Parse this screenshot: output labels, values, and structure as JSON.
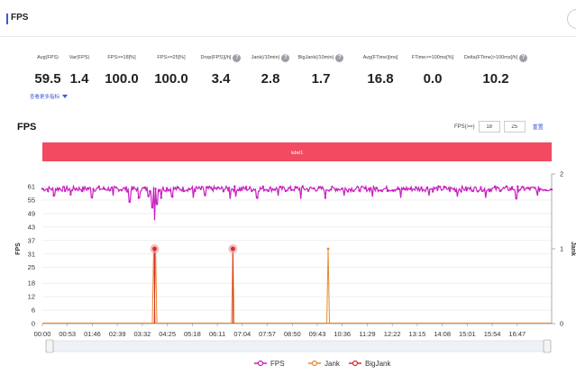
{
  "header": {
    "title": "FPS"
  },
  "metrics": [
    {
      "label": "Avg(FPS)",
      "value": "59.5",
      "help": false
    },
    {
      "label": "Var(FPS)",
      "value": "1.4",
      "help": false
    },
    {
      "label": "FPS>=18[%]",
      "value": "100.0",
      "help": false
    },
    {
      "label": "FPS>=25[%]",
      "value": "100.0",
      "help": false
    },
    {
      "label": "Drop(FPS)[/h]",
      "value": "3.4",
      "help": true
    },
    {
      "label": "Jank(/10min)",
      "value": "2.8",
      "help": true
    },
    {
      "label": "BigJank(/10min)",
      "value": "1.7",
      "help": true
    },
    {
      "label": "Avg(FTime)[ms]",
      "value": "16.8",
      "help": false
    },
    {
      "label": "FTime>=100ms[%]",
      "value": "0.0",
      "help": false
    },
    {
      "label": "Delta(FTime)>100ms[/h]",
      "value": "10.2",
      "help": true
    }
  ],
  "more_link": {
    "label": "查看更多指标"
  },
  "chart_header": {
    "title": "FPS"
  },
  "fps_filter": {
    "label": "FPS(>=)",
    "low": "18",
    "high": "25",
    "reset_label": "重置"
  },
  "chart_data": {
    "type": "line",
    "title": "FPS",
    "band_label": "label1",
    "ylabel": "FPS",
    "y2label": "Jank",
    "ylim": [
      0,
      61
    ],
    "y_ticks": [
      0,
      6,
      12,
      18,
      25,
      31,
      37,
      43,
      49,
      55,
      61
    ],
    "y2lim": [
      0,
      2
    ],
    "y2_ticks": [
      0,
      1,
      2
    ],
    "x_ticks": [
      "00:00",
      "00:53",
      "01:46",
      "02:39",
      "03:32",
      "04:25",
      "05:18",
      "06:11",
      "07:04",
      "07:57",
      "08:50",
      "09:43",
      "10:36",
      "11:29",
      "12:22",
      "13:15",
      "14:08",
      "15:01",
      "15:54",
      "16:47"
    ],
    "x_range_seconds": [
      0,
      1080
    ],
    "series": [
      {
        "name": "FPS",
        "color": "#c71fbf",
        "baseline": 60,
        "dips": [
          [
            25,
            57
          ],
          [
            60,
            57.5
          ],
          [
            105,
            56
          ],
          [
            150,
            57
          ],
          [
            185,
            54
          ],
          [
            205,
            56
          ],
          [
            225,
            56.5
          ],
          [
            233,
            51.5
          ],
          [
            238,
            46
          ],
          [
            243,
            53
          ],
          [
            252,
            56
          ],
          [
            275,
            56.5
          ],
          [
            320,
            56
          ],
          [
            345,
            57
          ],
          [
            398,
            55.5
          ],
          [
            410,
            56.5
          ],
          [
            455,
            56
          ],
          [
            500,
            57
          ],
          [
            548,
            55.5
          ],
          [
            600,
            56
          ],
          [
            640,
            57
          ],
          [
            700,
            56.5
          ],
          [
            760,
            56
          ],
          [
            820,
            57
          ],
          [
            880,
            56.5
          ],
          [
            940,
            56
          ],
          [
            1005,
            55.5
          ],
          [
            1050,
            57
          ]
        ]
      },
      {
        "name": "Jank",
        "color": "#e58a2c",
        "events": [
          [
            236,
            1
          ],
          [
            240,
            1
          ],
          [
            404,
            1
          ],
          [
            606,
            1
          ]
        ]
      },
      {
        "name": "BigJank",
        "color": "#d92b2b",
        "events": [
          [
            238,
            1
          ],
          [
            404,
            1
          ]
        ]
      }
    ],
    "legend_position": "bottom-center"
  }
}
